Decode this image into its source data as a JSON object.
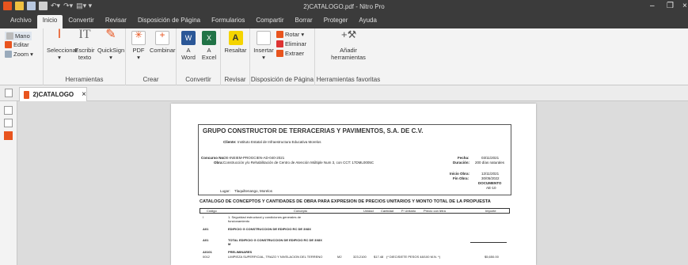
{
  "window": {
    "title": "2)CATALOGO.pdf - Nitro Pro"
  },
  "menu": [
    "Archivo",
    "Inicio",
    "Convertir",
    "Revisar",
    "Disposición de Página",
    "Formularios",
    "Compartir",
    "Borrar",
    "Proteger",
    "Ayuda"
  ],
  "ribbon": {
    "mano": "Mano",
    "editar": "Editar",
    "zoom": "Zoom",
    "herramientas": {
      "seleccionar": "Seleccionar",
      "escribir1": "Escribir",
      "escribir2": "texto",
      "quicksign": "QuickSign",
      "label": "Herramientas"
    },
    "crear": {
      "pdf": "PDF",
      "combinar": "Combinar",
      "label": "Crear"
    },
    "convertir": {
      "a1": "A",
      "word": "Word",
      "a2": "A",
      "excel": "Excel",
      "label": "Convertir"
    },
    "revisar": {
      "resaltar": "Resaltar",
      "label": "Revisar"
    },
    "disposicion": {
      "insertar": "Insertar",
      "rotar": "Rotar",
      "eliminar": "Eliminar",
      "extraer": "Extraer",
      "label": "Disposición de Página"
    },
    "favoritas": {
      "anadir1": "Añadir",
      "anadir2": "herramientas",
      "label": "Herramientas favoritas"
    }
  },
  "doctab": {
    "name": "2)CATALOGO",
    "close": "×"
  },
  "document": {
    "company": "GRUPO CONSTRUCTOR DE TERRACERIAS Y PAVIMENTOS, S.A. DE C.V.",
    "cliente_label": "Cliente:",
    "cliente": "Instituto Estatal de Infraestructura Educativa Morelos",
    "concurso_label": "Concurso No.",
    "concurso": "OE-INEIEM-PROGCIEN-AD-040-2021",
    "obra_label": "Obra:",
    "obra": "Construcción y/o Rehabilitación de Centro de Atención Múltiple Num 3, con CCT: 17DML0005C",
    "fecha_label": "Fecha:",
    "fecha": "03/11/2021",
    "duracion_label": "Duración:",
    "duracion": "200 días naturales",
    "inicio_label": "Inicio Obra:",
    "inicio": "12/11/2021",
    "fin_label": "Fin Obra:",
    "fin": "30/05/2022",
    "documento_label": "DOCUMENTO",
    "documento": "AE-10",
    "lugar_label": "Lugar:",
    "lugar": "Tlaquiltenango, Morelos",
    "catalog_title": "CATALOGO DE CONCEPTOS Y CANTIDADES DE OBRA PARA EXPRESION DE PRECIOS UNITARIOS Y MONTO TOTAL DE LA PROPUESTA",
    "columns": [
      "Código",
      "Concepto",
      "Unidad",
      "Cantidad",
      "P. Unitario",
      "Precio con letra",
      "Importe"
    ],
    "rows": [
      {
        "codigo": "I",
        "concepto": "1. Seguridad estructural y condiciones generales de funcionamiento",
        "unidad": "",
        "cantidad": "",
        "pu": "",
        "letra": "",
        "importe": ""
      },
      {
        "codigo": "A01",
        "concepto": "EDIFICIO G CONSTRUCCION DE EDIFICIO RC DE 3X8X",
        "unidad": "",
        "cantidad": "",
        "pu": "",
        "letra": "",
        "importe": ""
      },
      {
        "codigo": "A01",
        "concepto": "TOTAL EDIFICIO G CONSTRUCCION DE EDIFICIO RC DE 3X8X M",
        "unidad": "",
        "cantidad": "",
        "pu": "",
        "letra": "",
        "importe": ""
      },
      {
        "codigo": "A0101",
        "concepto": "PRELIMINARES",
        "unidad": "",
        "cantidad": "",
        "pu": "",
        "letra": "",
        "importe": ""
      },
      {
        "codigo": "0012",
        "concepto": "LIMPIEZA SUPERFICIAL, TRAZO Y NIVELACION DEL TERRENO",
        "unidad": "M2",
        "cantidad": "323.2100",
        "pu": "$17.48",
        "letra": "(* DIECISIETE PESOS 48/100 M.N. *)",
        "importe": "$5,650.00"
      }
    ]
  },
  "colors": {
    "titlebar": "#3b3b3b",
    "ribbon": "#f3f3f3",
    "accent": "#e8541e"
  }
}
